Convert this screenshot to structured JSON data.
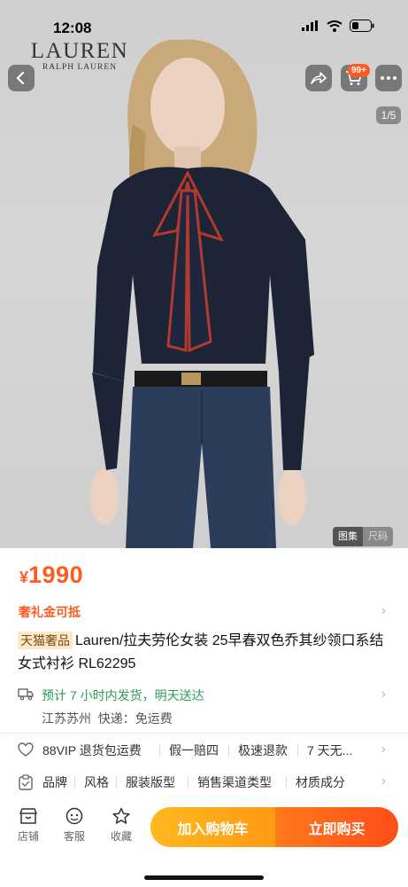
{
  "status_bar": {
    "time": "12:08"
  },
  "brand": {
    "main": "LAUREN",
    "sub": "RALPH LAUREN"
  },
  "top_nav": {
    "cart_badge": "99+"
  },
  "gallery": {
    "page_indicator": "1/5",
    "tabs": [
      "图集",
      "尺码"
    ]
  },
  "product": {
    "currency": "¥",
    "price": "1990",
    "gift_label": "奢礼金可抵",
    "store_tag": "天猫奢品",
    "title": "Lauren/拉夫劳伦女装 25早春双色乔其纱领口系结女式衬衫 RL62295"
  },
  "shipping": {
    "estimate": "预计 7 小时内发货，明天送达",
    "origin": "江苏苏州",
    "courier": "快递：免运费"
  },
  "services": [
    "88VIP 退货包运费",
    "假一赔四",
    "极速退款",
    "7 天无..."
  ],
  "params": [
    "品牌",
    "风格",
    "服装版型",
    "销售渠道类型",
    "材质成分"
  ],
  "bottom_bar": {
    "items": [
      "店铺",
      "客服",
      "收藏"
    ],
    "add_to_cart": "加入购物车",
    "buy_now": "立即购买"
  },
  "colors": {
    "accent": "#ff5a1f",
    "ship_green": "#2a9d5a",
    "cart_gradient": "#ffb81f",
    "buy_gradient": "#ff4d1a"
  },
  "icons": [
    "back-icon",
    "share-icon",
    "cart-icon",
    "more-icon",
    "truck-icon",
    "heart-check-icon",
    "clipboard-icon",
    "store-icon",
    "service-icon",
    "star-icon",
    "chevron-right-icon"
  ]
}
